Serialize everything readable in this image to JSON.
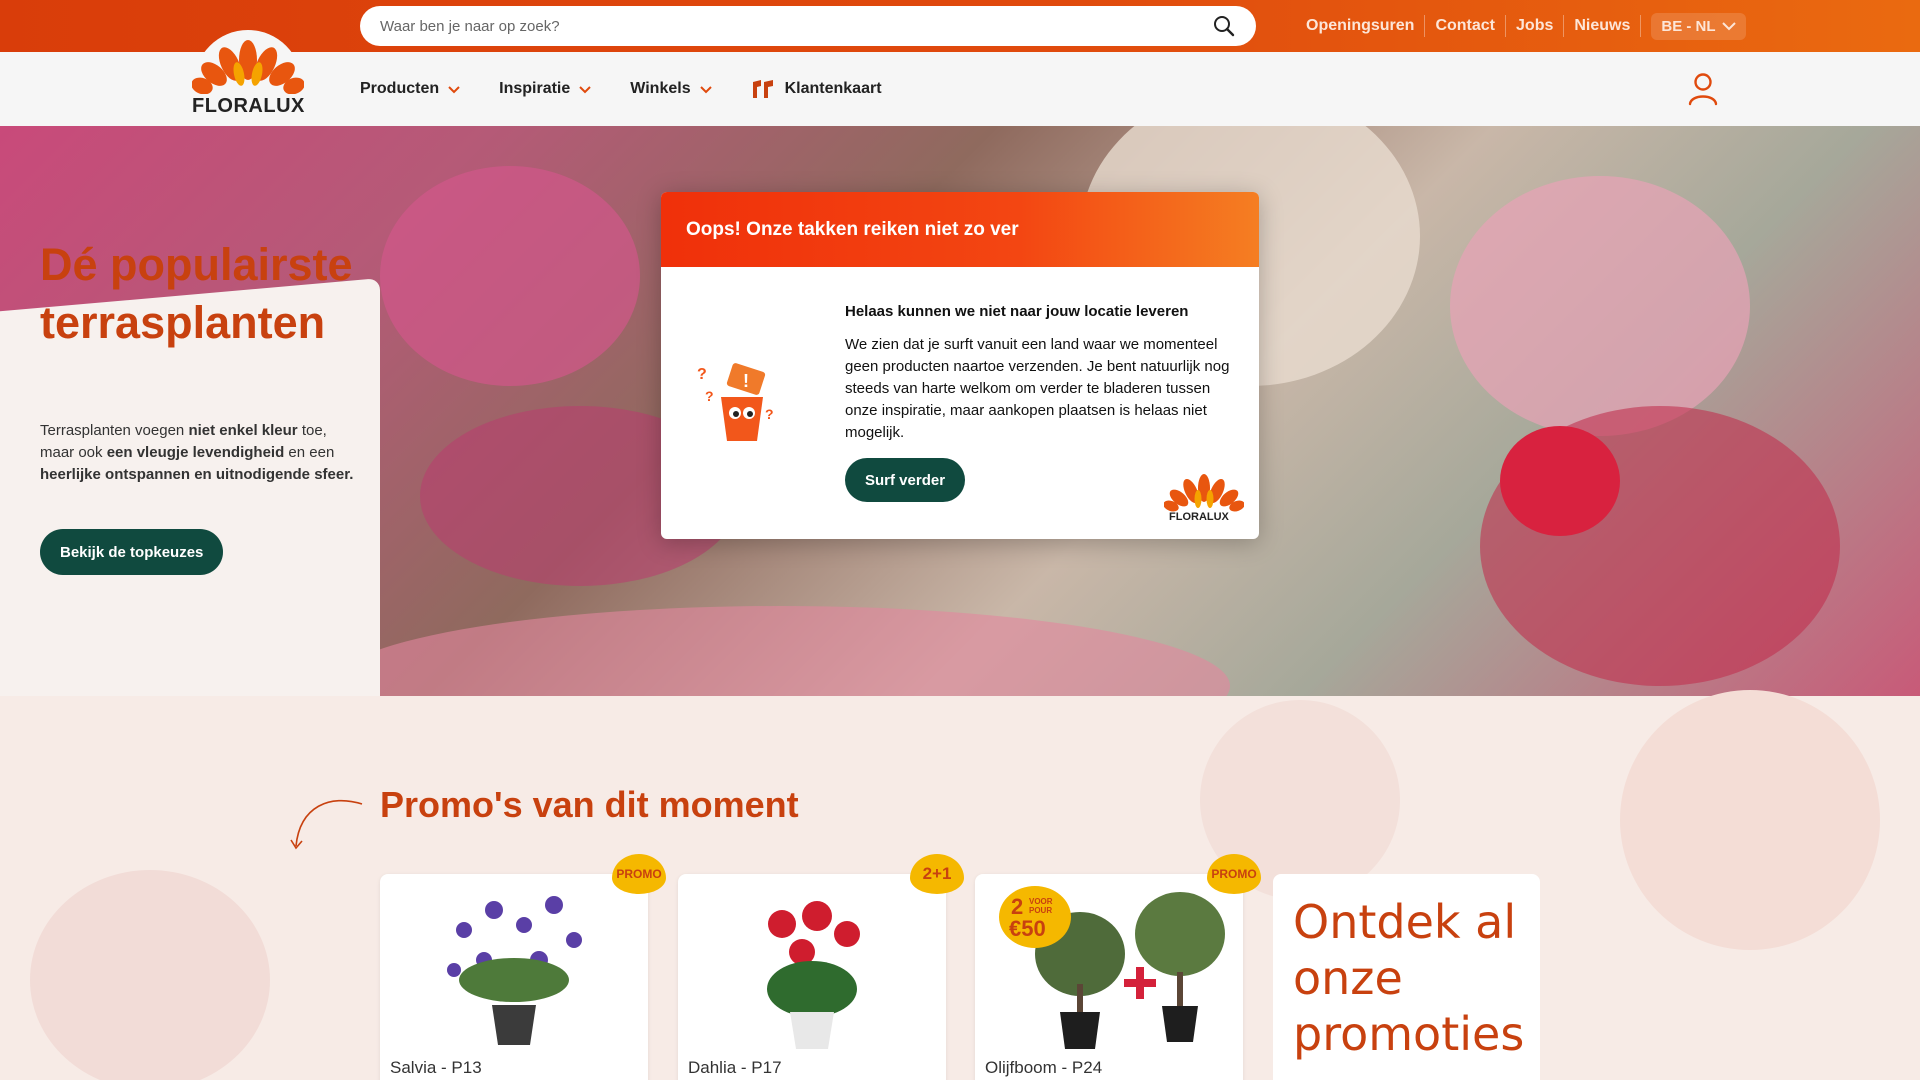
{
  "search": {
    "placeholder": "Waar ben je naar op zoek?"
  },
  "toplinks": [
    "Openingsuren",
    "Contact",
    "Jobs",
    "Nieuws"
  ],
  "language": "BE - NL",
  "brand": {
    "name": "FLORALUX",
    "accent": "#e04a0d",
    "green": "#104a3f",
    "title_color": "#c8410f"
  },
  "menu": {
    "producten": "Producten",
    "inspiratie": "Inspiratie",
    "winkels": "Winkels",
    "klantenkaart": "Klantenkaart"
  },
  "hero": {
    "title": "Dé populairste terrasplanten",
    "text_parts": [
      "Terrasplanten voegen ",
      "niet enkel kleur",
      " toe, maar ook ",
      "een vleugje levendigheid",
      " en een ",
      "heerlijke ontspannen en uitnodigende sfeer."
    ],
    "button": "Bekijk de topkeuzes"
  },
  "promos": {
    "title": "Promo's van dit moment",
    "items": [
      {
        "name": "Salvia - P13",
        "badge": "PROMO"
      },
      {
        "name": "Dahlia - P17",
        "badge": "2+1"
      },
      {
        "name": "Olijfboom - P24",
        "badge": "PROMO",
        "deal": [
          "2",
          "VOOR",
          "POUR",
          "€50"
        ]
      }
    ],
    "cta": "Ontdek al onze promoties"
  },
  "modal": {
    "title": "Oops! Onze takken reiken niet zo ver",
    "heading": "Helaas kunnen we niet naar jouw locatie leveren",
    "body": "We zien dat je surft vanuit een land waar we momenteel geen producten naartoe verzenden. Je bent natuurlijk nog steeds van harte welkom om verder te bladeren tussen onze inspiratie, maar aankopen plaatsen is helaas niet mogelijk.",
    "button": "Surf verder",
    "logo_text": "FLORALUX"
  }
}
